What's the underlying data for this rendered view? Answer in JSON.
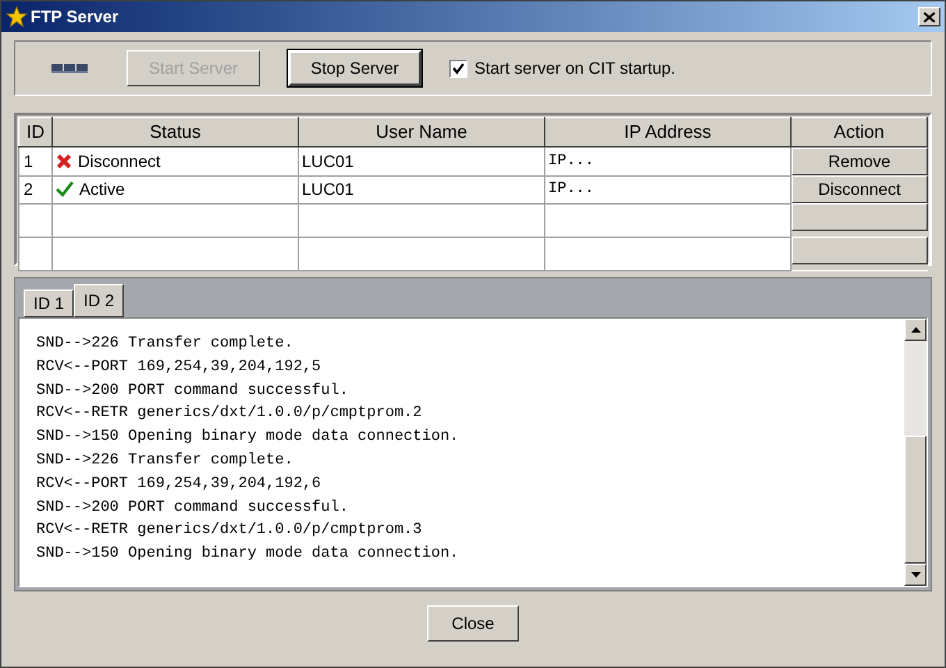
{
  "window": {
    "title": "FTP Server"
  },
  "toolbar": {
    "buttons": [
      {
        "label": "Start Server",
        "disabled": true
      },
      {
        "label": "Stop Server",
        "disabled": false
      }
    ],
    "checkbox": {
      "label": "Start server on CIT startup.",
      "checked": true
    }
  },
  "table": {
    "columns": [
      "ID",
      "Status",
      "User Name",
      "IP Address",
      "Action"
    ],
    "rows": [
      {
        "id": "1",
        "status": {
          "kind": "error",
          "label": "Disconnect"
        },
        "user": "LUC01",
        "ip": "IP...",
        "action": "Remove"
      },
      {
        "id": "2",
        "status": {
          "kind": "ok",
          "label": "Active"
        },
        "user": "LUC01",
        "ip": "IP...",
        "action": "Disconnect"
      },
      {},
      {}
    ]
  },
  "tabs": [
    {
      "label": "ID 1",
      "selected": false
    },
    {
      "label": "ID 2",
      "selected": true
    }
  ],
  "log": [
    "SND-->226 Transfer complete.",
    "RCV<--PORT 169,254,39,204,192,5",
    "SND-->200 PORT command successful.",
    "RCV<--RETR generics/dxt/1.0.0/p/cmptprom.2",
    "SND-->150 Opening binary mode data connection.",
    "SND-->226 Transfer complete.",
    "RCV<--PORT 169,254,39,204,192,6",
    "SND-->200 PORT command successful.",
    "RCV<--RETR generics/dxt/1.0.0/p/cmptprom.3",
    "SND-->150 Opening binary mode data connection."
  ],
  "footer": {
    "button": "Close"
  }
}
